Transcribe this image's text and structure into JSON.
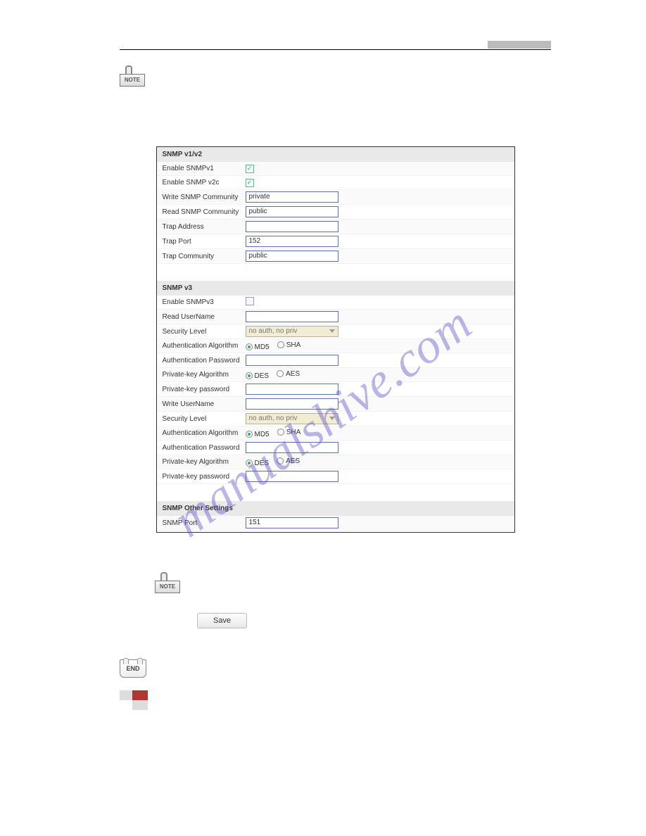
{
  "watermark": "manualshive.com",
  "note_label": "NOTE",
  "snmp": {
    "section1": "SNMP v1/v2",
    "enable_v1_label": "Enable SNMPv1",
    "enable_v1_checked": true,
    "enable_v2c_label": "Enable SNMP v2c",
    "enable_v2c_checked": true,
    "write_comm_label": "Write SNMP Community",
    "write_comm_value": "private",
    "read_comm_label": "Read SNMP Community",
    "read_comm_value": "public",
    "trap_addr_label": "Trap Address",
    "trap_addr_value": "",
    "trap_port_label": "Trap Port",
    "trap_port_value": "152",
    "trap_comm_label": "Trap Community",
    "trap_comm_value": "public",
    "section2": "SNMP v3",
    "enable_v3_label": "Enable SNMPv3",
    "enable_v3_checked": false,
    "read_user_label": "Read UserName",
    "read_user_value": "",
    "sec_level_label": "Security Level",
    "sec_level_value": "no auth, no priv",
    "auth_algo_label": "Authentication Algorithm",
    "auth_md5": "MD5",
    "auth_sha": "SHA",
    "auth_pw_label": "Authentication Password",
    "auth_pw_value": "",
    "pk_algo_label": "Private-key Algorithm",
    "pk_des": "DES",
    "pk_aes": "AES",
    "pk_pw_label": "Private-key password",
    "pk_pw_value": "",
    "write_user_label": "Write UserName",
    "write_user_value": "",
    "section3": "SNMP Other Settings",
    "snmp_port_label": "SNMP Port",
    "snmp_port_value": "151"
  },
  "save_label": "Save",
  "end_label": "END"
}
